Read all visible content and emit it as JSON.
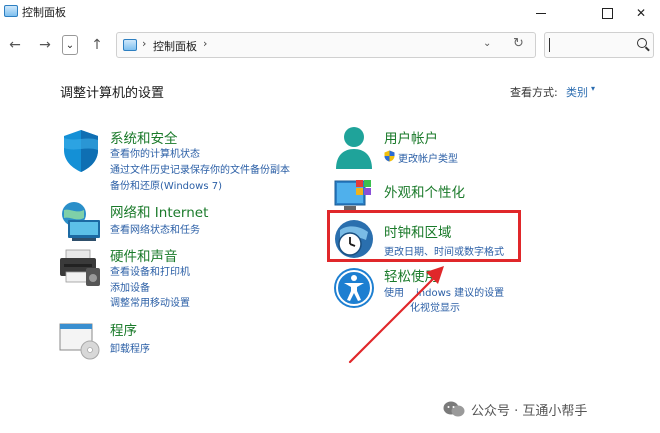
{
  "window": {
    "title": "控制面板"
  },
  "navbar": {
    "back_glyph": "←",
    "forward_glyph": "→",
    "history_glyph": "⌄",
    "up_glyph": "↑",
    "breadcrumb_sep": "›",
    "breadcrumb_current": "控制面板",
    "dropdown_glyph": "⌄",
    "refresh_glyph": "↻",
    "search_value": ""
  },
  "header": {
    "title": "调整计算机的设置",
    "view_label": "查看方式:",
    "view_value": "类别",
    "view_caret": "▾"
  },
  "categories": [
    {
      "title": "系统和安全",
      "icon": "shield-icon",
      "links": [
        "查看你的计算机状态",
        "通过文件历史记录保存你的文件备份副本",
        "备份和还原(Windows 7)"
      ]
    },
    {
      "title": "网络和 Internet",
      "icon": "network-icon",
      "links": [
        "查看网络状态和任务"
      ]
    },
    {
      "title": "硬件和声音",
      "icon": "printer-icon",
      "links": [
        "查看设备和打印机",
        "添加设备",
        "调整常用移动设置"
      ]
    },
    {
      "title": "程序",
      "icon": "programs-icon",
      "links": [
        "卸载程序"
      ]
    },
    {
      "title": "用户帐户",
      "icon": "user-icon",
      "links": [
        "更改帐户类型"
      ]
    },
    {
      "title": "外观和个性化",
      "icon": "appearance-icon",
      "links": []
    },
    {
      "title": "时钟和区域",
      "icon": "clock-icon",
      "links": [
        "更改日期、时间或数字格式"
      ]
    },
    {
      "title": "轻松使用",
      "icon": "accessibility-icon",
      "links": [
        "使用",
        "indows 建议的设置",
        "化视觉显示"
      ]
    }
  ],
  "watermark": {
    "text": "公众号 · 互通小帮手"
  },
  "colors": {
    "category_title": "#1a7a2a",
    "link": "#2b5fa6",
    "highlight": "#e0272a"
  }
}
